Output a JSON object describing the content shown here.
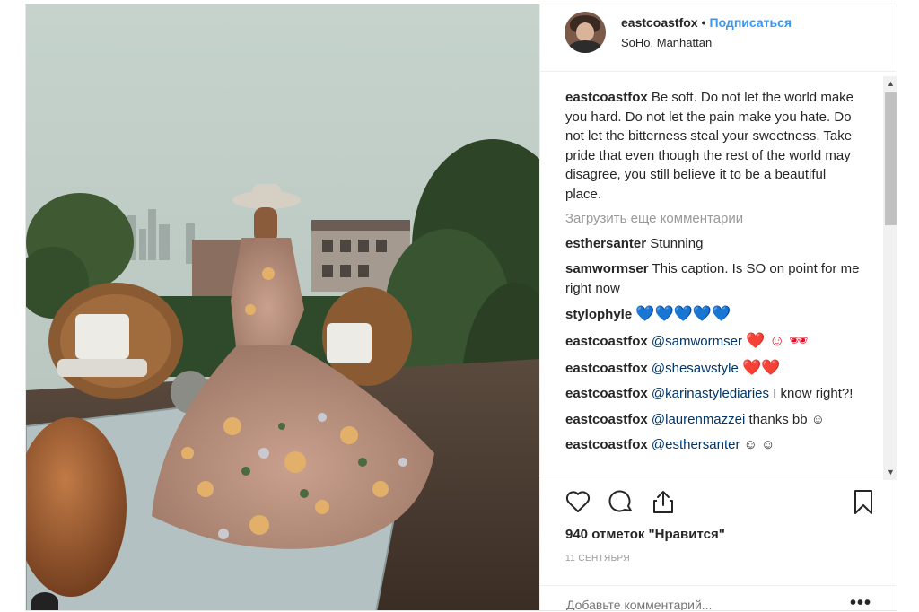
{
  "post": {
    "username": "eastcoastfox",
    "follow_label": "Подписаться",
    "separator": "•",
    "location": "SoHo, Manhattan",
    "caption": "Be soft. Do not let the world make you hard. Do not let the pain make you hate. Do not let the bitterness steal your sweetness. Take pride that even though the rest of the world may disagree, you still believe it to be a beautiful place.",
    "load_more": "Загрузить еще комментарии",
    "comments": [
      {
        "user": "esthersanter",
        "mention": "",
        "text": "Stunning"
      },
      {
        "user": "samwormser",
        "mention": "",
        "text": "This caption. Is SO on point for me right now"
      },
      {
        "user": "stylophyle",
        "mention": "",
        "text": "💙💙💙💙💙"
      },
      {
        "user": "eastcoastfox",
        "mention": "@samwormser",
        "text": "❤️ ☺ 🕶"
      },
      {
        "user": "eastcoastfox",
        "mention": "@shesawstyle",
        "text": "❤️❤️"
      },
      {
        "user": "eastcoastfox",
        "mention": "@karinastylediaries",
        "text": "I know right?!"
      },
      {
        "user": "eastcoastfox",
        "mention": "@laurenmazzei",
        "text": "thanks bb ☺"
      },
      {
        "user": "eastcoastfox",
        "mention": "@esthersanter",
        "text": "☺ ☺"
      }
    ],
    "likes": "940 отметок \"Нравится\"",
    "date": "11 СЕНТЯБРЯ",
    "add_comment_placeholder": "Добавьте комментарий...",
    "more_label": "•••"
  },
  "icons": {
    "like": "heart-icon",
    "comment": "comment-icon",
    "share": "share-icon",
    "save": "bookmark-icon"
  },
  "colors": {
    "link": "#3897f0",
    "mention": "#003569",
    "muted": "#999999"
  }
}
